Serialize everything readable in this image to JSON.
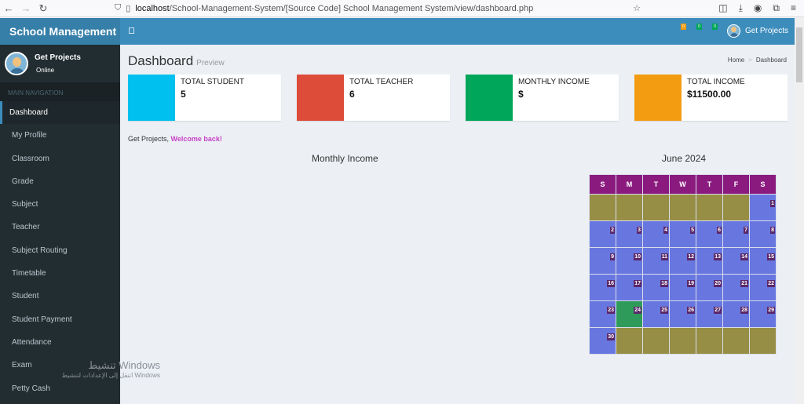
{
  "browser": {
    "url_host": "localhost",
    "url_path": "/School-Management-System/[Source Code] School Management System/view/dashboard.php"
  },
  "sidebar": {
    "brand": "School Management",
    "user_name": "Get Projects",
    "user_status": "Online",
    "nav_header": "MAIN NAVIGATION",
    "items": [
      {
        "label": "Dashboard"
      },
      {
        "label": "My Profile"
      },
      {
        "label": "Classroom"
      },
      {
        "label": "Grade"
      },
      {
        "label": "Subject"
      },
      {
        "label": "Teacher"
      },
      {
        "label": "Subject Routing"
      },
      {
        "label": "Timetable"
      },
      {
        "label": "Student"
      },
      {
        "label": "Student Payment"
      },
      {
        "label": "Attendance"
      },
      {
        "label": "Exam"
      },
      {
        "label": "Petty Cash"
      }
    ]
  },
  "topbar": {
    "badges": [
      "0",
      "0",
      "0"
    ],
    "user_name": "Get Projects"
  },
  "page": {
    "title": "Dashboard",
    "subtitle": "Preview",
    "breadcrumb": [
      "Home",
      "Dashboard"
    ],
    "welcome_prefix": "Get Projects,",
    "welcome_text": "Welcome back!",
    "chart_title": "Monthly Income"
  },
  "stats": [
    {
      "label": "TOTAL STUDENT",
      "value": "5",
      "color": "#00c0ef"
    },
    {
      "label": "TOTAL TEACHER",
      "value": "6",
      "color": "#dd4b39"
    },
    {
      "label": "MONTHLY INCOME",
      "value": "$",
      "color": "#00a65a"
    },
    {
      "label": "TOTAL INCOME",
      "value": "$11500.00",
      "color": "#f39c12"
    }
  ],
  "calendar": {
    "title": "June 2024",
    "days": [
      "S",
      "M",
      "T",
      "W",
      "T",
      "F",
      "S"
    ],
    "first_weekday": 6,
    "num_days": 30,
    "today": 24
  },
  "watermark": {
    "line1": "تنشيط Windows",
    "line2": "انتقل إلى الإعدادات لتنشيط Windows"
  }
}
